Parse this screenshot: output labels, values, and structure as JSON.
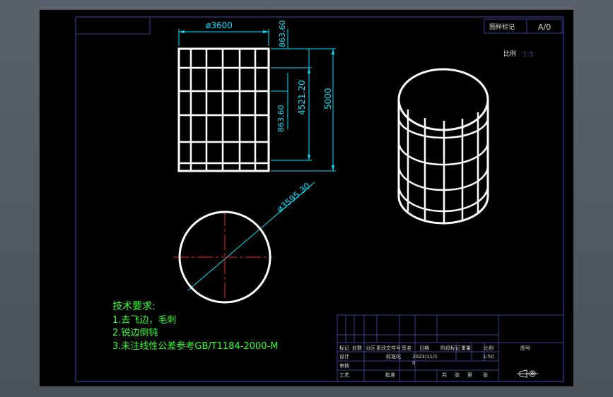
{
  "title_block": {
    "top_label": "图样标记",
    "top_value": "A/0",
    "ratio_label": "比例",
    "ratio_value": "1:5",
    "header_cells": [
      "标记",
      "处数",
      "分区",
      "更改文件号",
      "签名",
      "日期",
      "阶段标记",
      "重量",
      "比例"
    ],
    "design_label": "设计",
    "std_label": "标准化",
    "design_date": "2023/11/1",
    "design_mark": "0",
    "scale": "1:50",
    "review_label": "审核",
    "process_label": "工艺",
    "approve_label": "批准",
    "sheet_cells": [
      "共",
      "张",
      "第",
      "张"
    ],
    "material_label": "图号"
  },
  "notes": {
    "heading": "技术要求:",
    "lines": [
      "1.去飞边，毛刺",
      "2.锐边倒钝",
      "3.未注线性公差参考GB/T1184-2000-M"
    ]
  },
  "dimensions": {
    "width": "ø3600",
    "top_gap": "863.60",
    "middle": "4521.20",
    "mid_gap": "863.60",
    "height": "5000",
    "diameter": "ø3595.30"
  },
  "colors": {
    "background": "#000000",
    "frame": "#3a3f8f",
    "outline": "#ffffff",
    "dimension": "#00e5ff",
    "centerline": "#ff2020",
    "notes": "#33ff33"
  }
}
